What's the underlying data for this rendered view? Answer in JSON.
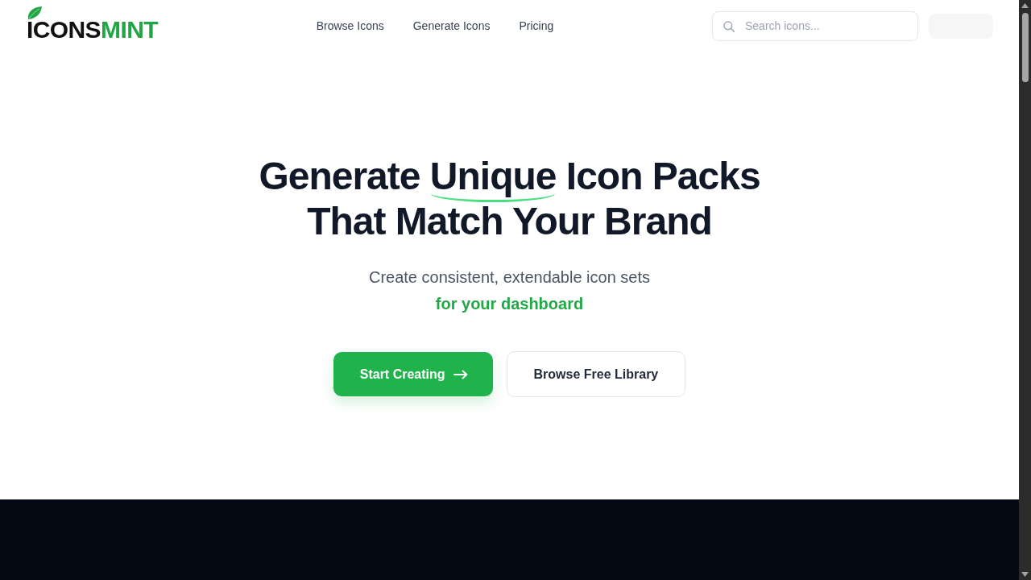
{
  "header": {
    "logo": {
      "dark_text": "ICONS",
      "accent_text": "MINT"
    },
    "nav_links": [
      "Browse Icons",
      "Generate Icons",
      "Pricing"
    ],
    "search": {
      "placeholder": "Search icons..."
    }
  },
  "hero": {
    "heading": {
      "before": "Generate ",
      "highlight": "Unique",
      "after": " Icon Packs That Match Your Brand"
    },
    "subtitle": "Create consistent, extendable icon sets",
    "highlight_line": "for your dashboard",
    "buttons": [
      {
        "label": "Start Creating",
        "kind": "primary"
      },
      {
        "label": "Browse Free Library",
        "kind": "secondary"
      }
    ]
  }
}
